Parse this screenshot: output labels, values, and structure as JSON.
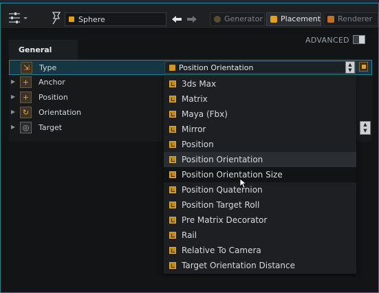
{
  "toolbar": {
    "object_name": "Sphere",
    "tabs": [
      {
        "label": "Generator",
        "icon": "sphere-icon",
        "color": "#8a6a3a"
      },
      {
        "label": "Placement",
        "icon": "placement-icon",
        "color": "#e0a020"
      },
      {
        "label": "Renderer",
        "icon": "renderer-icon",
        "color": "#c07020"
      }
    ],
    "active_tab": "Placement"
  },
  "panel": {
    "advanced_label": "ADVANCED",
    "section_tab": "General",
    "properties": [
      {
        "label": "Type",
        "icon": "type-icon",
        "selected": true
      },
      {
        "label": "Anchor",
        "icon": "anchor-icon"
      },
      {
        "label": "Position",
        "icon": "position-icon"
      },
      {
        "label": "Orientation",
        "icon": "orientation-icon"
      },
      {
        "label": "Target",
        "icon": "target-icon"
      }
    ],
    "type_value": "Position Orientation"
  },
  "dropdown": {
    "items": [
      "3ds Max",
      "Matrix",
      "Maya (Fbx)",
      "Mirror",
      "Position",
      "Position Orientation",
      "Position Orientation Size",
      "Position Quaternion",
      "Position Target Roll",
      "Pre Matrix Decorator",
      "Rail",
      "Relative To Camera",
      "Target Orientation Distance"
    ],
    "selected": "Position Orientation",
    "hovered": "Position Orientation Size"
  },
  "colors": {
    "accent": "#2d7f93",
    "icon_orange": "#e0a020",
    "background": "#121416"
  }
}
